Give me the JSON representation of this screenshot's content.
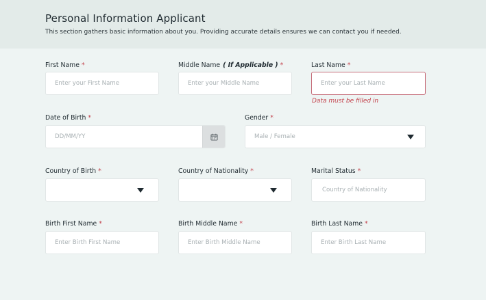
{
  "header": {
    "title": "Personal Information Applicant",
    "subtitle": "This section gathers basic information about you. Providing accurate details ensures we can contact you if needed."
  },
  "fields": {
    "first_name": {
      "label": "First Name",
      "required": "*",
      "placeholder": "Enter your First Name",
      "value": ""
    },
    "middle_name": {
      "label": "Middle Name",
      "note": "( If Applicable )",
      "required": "*",
      "placeholder": "Enter your Middle Name",
      "value": ""
    },
    "last_name": {
      "label": "Last Name",
      "required": "*",
      "placeholder": "Enter your Last Name",
      "value": "",
      "error": "Data must be filled in"
    },
    "dob": {
      "label": "Date of Birth",
      "required": "*",
      "placeholder": "DD/MM/YY",
      "value": ""
    },
    "gender": {
      "label": "Gender",
      "required": "*",
      "placeholder": "Male / Female"
    },
    "country_birth": {
      "label": "Country of Birth",
      "required": "*",
      "placeholder": ""
    },
    "country_nationality": {
      "label": "Country of Nationality",
      "required": "*",
      "placeholder": ""
    },
    "marital_status": {
      "label": "Marital Status",
      "required": "*",
      "placeholder": "Country of Nationality",
      "value": ""
    },
    "birth_first_name": {
      "label": "Birth First Name",
      "required": "*",
      "placeholder": "Enter Birth First Name",
      "value": ""
    },
    "birth_middle_name": {
      "label": "Birth Middle Name",
      "required": "*",
      "placeholder": "Enter Birth Middle Name",
      "value": ""
    },
    "birth_last_name": {
      "label": "Birth Last Name",
      "required": "*",
      "placeholder": "Enter Birth Last Name",
      "value": ""
    }
  },
  "colors": {
    "required": "#c2404a",
    "error_border": "#c56b78",
    "background": "#eef4f3",
    "header_bg": "#e3ebe9"
  },
  "icons": {
    "date_picker": "calendar-icon",
    "dropdown": "caret-down-icon"
  }
}
